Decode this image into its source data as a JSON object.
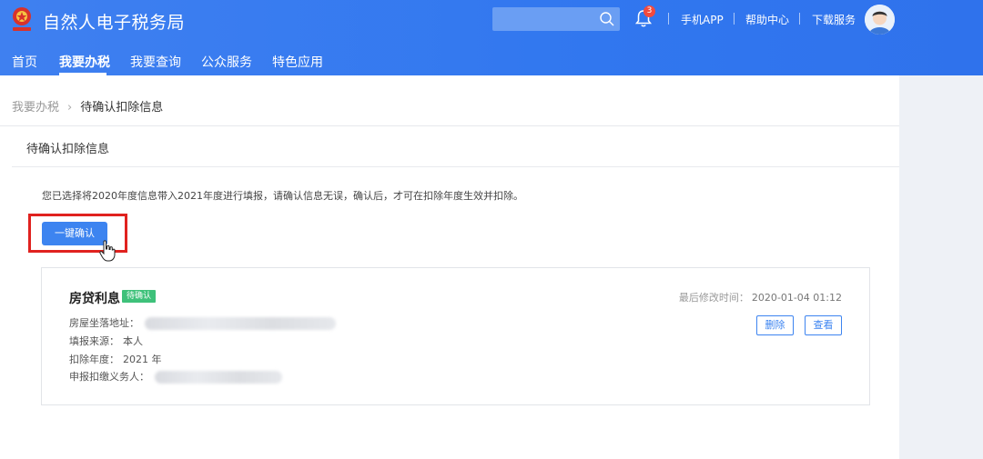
{
  "header": {
    "site_title": "自然人电子税务局",
    "search_placeholder": "",
    "notification_count": "3",
    "links": [
      "手机APP",
      "帮助中心",
      "下载服务"
    ],
    "accent_color": "#3177ef"
  },
  "nav": {
    "items": [
      "首页",
      "我要办税",
      "我要查询",
      "公众服务",
      "特色应用"
    ],
    "active": "我要办税"
  },
  "breadcrumb": {
    "parent": "我要办税",
    "current": "待确认扣除信息"
  },
  "panel": {
    "title": "待确认扣除信息",
    "notice": "您已选择将2020年度信息带入2021年度进行填报，请确认信息无误，确认后，才可在扣除年度生效并扣除。",
    "confirm_button": "一键确认"
  },
  "card": {
    "title": "房贷利息",
    "status": "待确认",
    "status_color": "#3ec17a",
    "modified_label": "最后修改时间：",
    "modified_value": "2020-01-04 01:12",
    "fields": {
      "address_label": "房屋坐落地址：",
      "source_label": "填报来源：",
      "source_value": "本人",
      "year_label": "扣除年度：",
      "year_value": "2021 年",
      "withholder_label": "申报扣缴义务人："
    },
    "delete_button": "删除",
    "view_button": "查看"
  }
}
